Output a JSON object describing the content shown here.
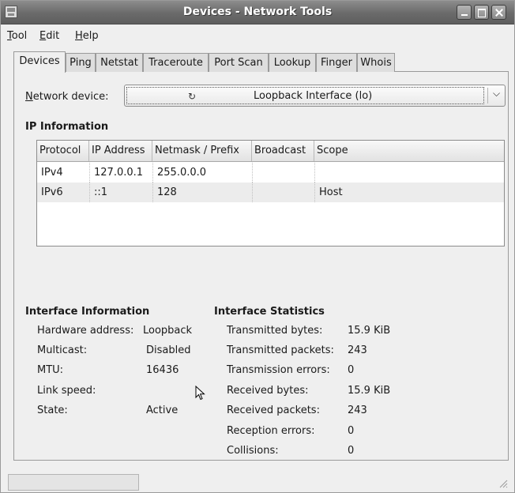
{
  "window": {
    "title": "Devices - Network Tools",
    "controls": [
      "minimize",
      "maximize",
      "close"
    ]
  },
  "menubar": {
    "items": [
      {
        "label": "Tool",
        "accel": "T",
        "rest": "ool"
      },
      {
        "label": "Edit",
        "accel": "E",
        "rest": "dit"
      },
      {
        "label": "Help",
        "accel": "H",
        "rest": "elp"
      }
    ]
  },
  "tabs": [
    "Devices",
    "Ping",
    "Netstat",
    "Traceroute",
    "Port Scan",
    "Lookup",
    "Finger",
    "Whois"
  ],
  "active_tab": "Devices",
  "network_device": {
    "label_accel": "N",
    "label_rest": "etwork device:",
    "value": "Loopback Interface (lo)",
    "icon": "loopback-icon"
  },
  "ip_information": {
    "title": "IP Information",
    "columns": [
      "Protocol",
      "IP Address",
      "Netmask / Prefix",
      "Broadcast",
      "Scope"
    ],
    "rows": [
      [
        "IPv4",
        "127.0.0.1",
        "255.0.0.0",
        "",
        ""
      ],
      [
        "IPv6",
        "::1",
        "128",
        "",
        "Host"
      ]
    ]
  },
  "interface_information": {
    "title": "Interface Information",
    "fields": [
      {
        "label": "Hardware address:",
        "value": "Loopback"
      },
      {
        "label": "Multicast:",
        "value": "Disabled"
      },
      {
        "label": "MTU:",
        "value": "16436"
      },
      {
        "label": "Link speed:",
        "value": ""
      },
      {
        "label": "State:",
        "value": "Active"
      }
    ]
  },
  "interface_statistics": {
    "title": "Interface Statistics",
    "fields": [
      {
        "label": "Transmitted bytes:",
        "value": "15.9 KiB"
      },
      {
        "label": "Transmitted packets:",
        "value": "243"
      },
      {
        "label": "Transmission errors:",
        "value": "0"
      },
      {
        "label": "Received bytes:",
        "value": "15.9 KiB"
      },
      {
        "label": "Received packets:",
        "value": "243"
      },
      {
        "label": "Reception errors:",
        "value": "0"
      },
      {
        "label": "Collisions:",
        "value": "0"
      }
    ]
  },
  "statusbar": {
    "text": ""
  }
}
